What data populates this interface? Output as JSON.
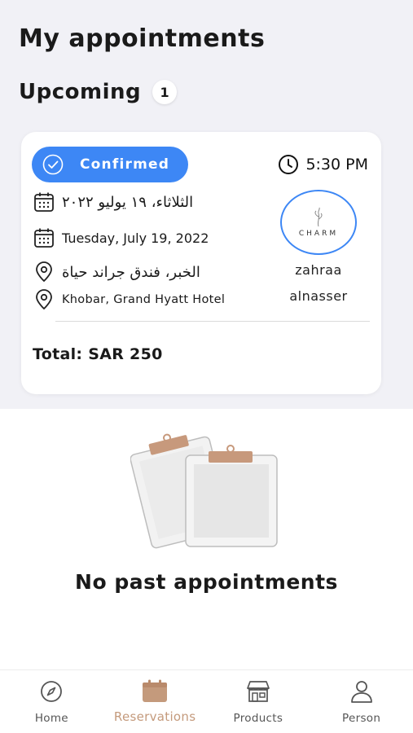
{
  "page": {
    "title": "My appointments"
  },
  "upcoming": {
    "title": "Upcoming",
    "count": "1"
  },
  "appointment": {
    "status": "Confirmed",
    "time": "5:30 PM",
    "date_ar": "الثلاثاء، ١٩ يوليو ٢٠٢٢",
    "date_en": "Tuesday, July 19, 2022",
    "location_ar": "الخبر، فندق جراند حياة",
    "location_en": "Khobar, Grand Hyatt Hotel",
    "provider_logo_text": "CHARM",
    "provider_first": "zahraa",
    "provider_last": "alnasser",
    "total": "Total: SAR 250"
  },
  "past": {
    "empty_message": "No past appointments"
  },
  "tabs": [
    {
      "label": "Home",
      "icon": "compass-icon"
    },
    {
      "label": "Reservations",
      "icon": "calendar-icon"
    },
    {
      "label": "Products",
      "icon": "store-icon"
    },
    {
      "label": "Person",
      "icon": "person-icon"
    }
  ],
  "colors": {
    "accent_blue": "#3d87f5",
    "accent_tan": "#c49a7c",
    "background_gray": "#f1f1f6"
  }
}
